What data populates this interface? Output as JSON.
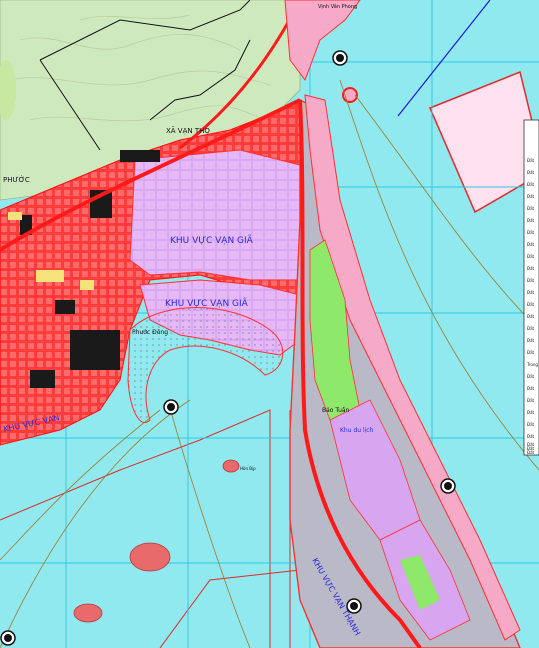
{
  "map": {
    "colors": {
      "sea": "#8fe9ee",
      "land_green": "#c9e6b8",
      "urban_red": "#ff3030",
      "residential_pink": "#f5a3c7",
      "development_lilac": "#d8a6f0",
      "park_green": "#8ee86a",
      "sand_grey": "#b9b9c8",
      "island": "#e86a6a",
      "border_blue": "#1b1bd6",
      "grid_cyan": "#4ad8ee",
      "contour_brown": "#a07a2c"
    },
    "labels": {
      "commune_top": "XÃ VẠN THỌ",
      "district_left": "PHƯỚC",
      "zone_upper": "KHU VỰC VẠN GIÃ",
      "zone_middle": "KHU VỰC VẠN GIÃ",
      "harbor": "Phước Đông",
      "zone_left_bottom": "KHU VỰC VẠN",
      "peninsula_mid": "Bảo Tuấn",
      "peninsula_note": "Khu du lịch",
      "peninsula_zone": "KHU VỰC VẠN THẠNH",
      "island_small": "Hòn Bịp",
      "top_place": "Vịnh Vân Phong"
    },
    "markers": [
      {
        "name": "north-beacon"
      },
      {
        "name": "harbor-beacon"
      },
      {
        "name": "peninsula-beacon"
      },
      {
        "name": "east-beacon"
      },
      {
        "name": "southwest-beacon"
      }
    ],
    "legend": {
      "rows": [
        "Đất",
        "Đất",
        "Đất",
        "Đất",
        "Đất",
        "Đất",
        "Đất",
        "Đất",
        "Đất",
        "Đất",
        "Đất",
        "Đất",
        "Đất",
        "Đất",
        "Đất",
        "Đất",
        "Đất",
        "Trong",
        "Đất",
        "Đất",
        "Đất",
        "Đất",
        "Đất",
        "Đất",
        "Đất",
        "Đất",
        "Đất"
      ]
    }
  }
}
